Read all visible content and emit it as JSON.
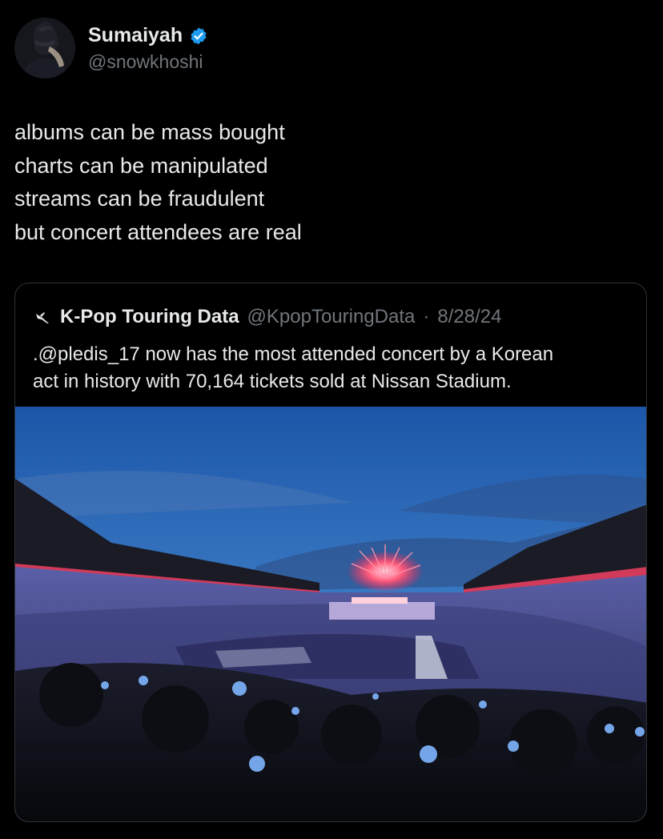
{
  "author": {
    "name": "Sumaiyah",
    "handle": "@snowkhoshi",
    "verified_icon": "verified-badge-icon"
  },
  "tweet": {
    "lines": [
      "albums can be mass bought",
      "charts can be manipulated",
      "streams can be fraudulent",
      "but concert attendees are real"
    ]
  },
  "quote": {
    "logo_icon": "airplane-icon",
    "name": "K-Pop Touring Data",
    "handle": "@KpopTouringData",
    "separator": "·",
    "date": "8/28/24",
    "lines": [
      ".@pledis_17 now has the most attended concert by a Korean",
      "act in history with 70,164 tickets sold at Nissan Stadium."
    ]
  },
  "colors": {
    "background": "#000000",
    "text": "#e7e9ea",
    "secondary_text": "#71767b",
    "verified": "#1d9bf0",
    "border": "#2f3336"
  }
}
